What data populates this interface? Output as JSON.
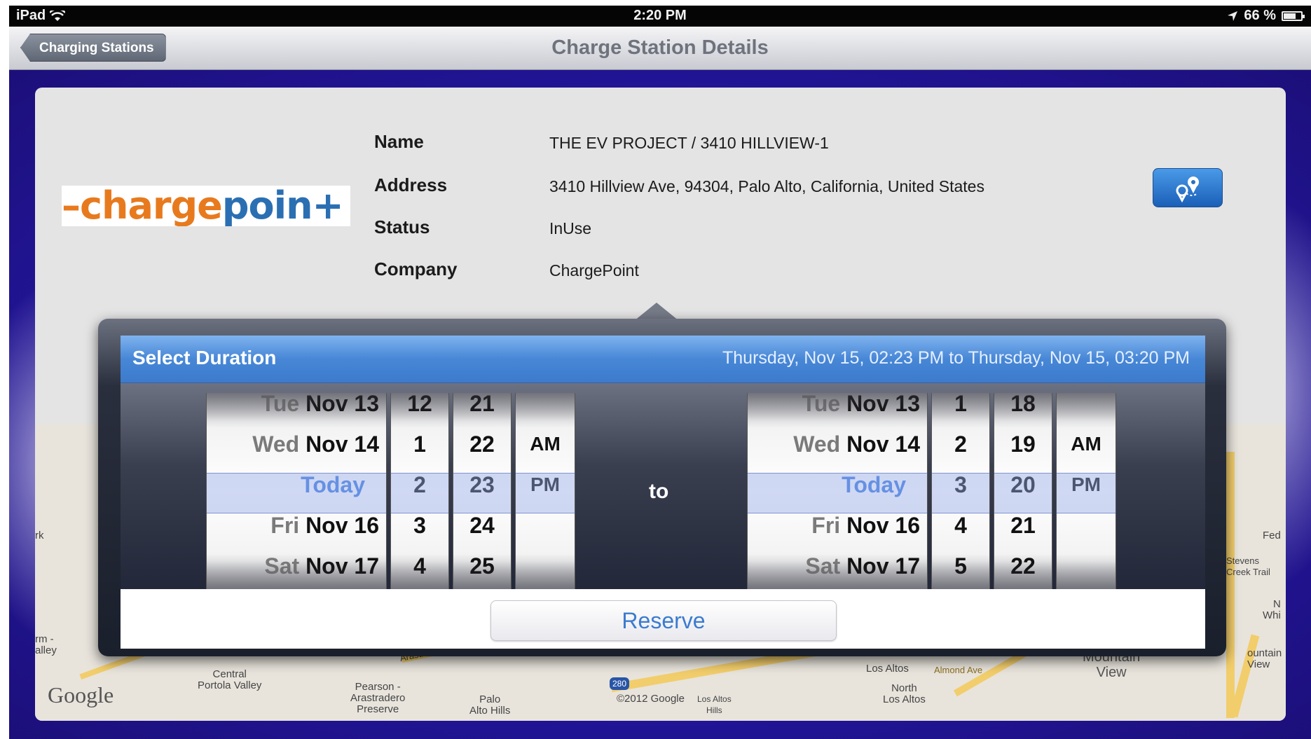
{
  "status_bar": {
    "device": "iPad",
    "time": "2:20 PM",
    "battery": "66 %",
    "battery_fraction": 0.66
  },
  "nav": {
    "back_label": "Charging Stations",
    "title": "Charge Station Details"
  },
  "logo": {
    "text_orange": "–charge",
    "text_blue": "poin+"
  },
  "details": [
    {
      "label": "Name",
      "value": "THE EV PROJECT / 3410 HILLVIEW-1"
    },
    {
      "label": "Address",
      "value": "3410 Hillview Ave, 94304, Palo Alto, California, United States"
    },
    {
      "label": "Status",
      "value": "InUse"
    },
    {
      "label": "Company",
      "value": "ChargePoint"
    }
  ],
  "popover": {
    "title": "Select Duration",
    "range": "Thursday, Nov 15, 02:23 PM to Thursday, Nov 15, 03:20 PM",
    "to_label": "to",
    "reserve_label": "Reserve",
    "start": {
      "dates": [
        {
          "day": "Tue",
          "date": "Nov 13"
        },
        {
          "day": "Wed",
          "date": "Nov 14"
        },
        {
          "day": "",
          "date": "Today"
        },
        {
          "day": "Fri",
          "date": "Nov 16"
        },
        {
          "day": "Sat",
          "date": "Nov 17"
        }
      ],
      "hours": [
        "12",
        "1",
        "2",
        "3",
        "4"
      ],
      "minutes": [
        "21",
        "22",
        "23",
        "24",
        "25"
      ],
      "ampm": [
        "",
        "AM",
        "PM",
        "",
        ""
      ]
    },
    "end": {
      "dates": [
        {
          "day": "Tue",
          "date": "Nov 13"
        },
        {
          "day": "Wed",
          "date": "Nov 14"
        },
        {
          "day": "",
          "date": "Today"
        },
        {
          "day": "Fri",
          "date": "Nov 16"
        },
        {
          "day": "Sat",
          "date": "Nov 17"
        }
      ],
      "hours": [
        "1",
        "2",
        "3",
        "4",
        "5"
      ],
      "minutes": [
        "18",
        "19",
        "20",
        "21",
        "22"
      ],
      "ampm": [
        "",
        "AM",
        "PM",
        "",
        ""
      ]
    }
  },
  "map": {
    "google": "Google",
    "labels": {
      "central_portola": "Central\nPortola Valley",
      "pearson": "Pearson -\nArastradero\nPreserve",
      "palo_alto_hills": "Palo\nAlto Hills",
      "copyright": "©2012 Google",
      "los_altos_hills": "Los Altos\nHills",
      "los_altos": "Los Altos",
      "almond_ave": "Almond Ave",
      "north_los_altos": "North\nLos Altos",
      "mountain_view": "Mountain\nView",
      "route_280": "280",
      "arastradero_rd": "Arastradero Rd",
      "fed": "Fed",
      "stevens_creek": "Stevens\nCreek Trail",
      "n_whi": "N\nWhi",
      "fountain_view": "ountain\nView",
      "rk": "rk",
      "rm_alley": "rm -\nalley"
    }
  },
  "colors": {
    "accent_blue": "#3f7de0",
    "logo_orange": "#e87a1e",
    "logo_blue": "#2b6fb3",
    "background_blue": "#2518a8"
  }
}
